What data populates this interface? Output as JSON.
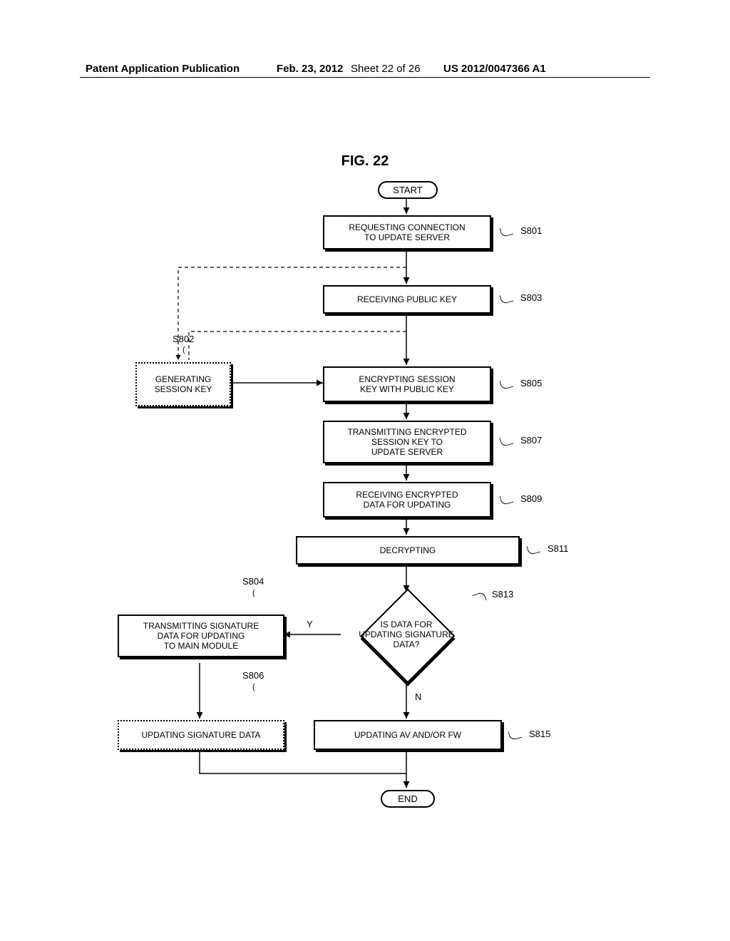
{
  "header": {
    "pub": "Patent Application Publication",
    "date": "Feb. 23, 2012",
    "sheet": "Sheet 22 of 26",
    "docnum": "US 2012/0047366 A1"
  },
  "figure_title": "FIG. 22",
  "nodes": {
    "start": "START",
    "s801": "REQUESTING CONNECTION\nTO UPDATE SERVER",
    "s803": "RECEIVING PUBLIC KEY",
    "s805": "ENCRYPTING SESSION\nKEY WITH PUBLIC KEY",
    "s807": "TRANSMITTING ENCRYPTED\nSESSION KEY TO\nUPDATE SERVER",
    "s809": "RECEIVING ENCRYPTED\nDATA FOR UPDATING",
    "s811": "DECRYPTING",
    "s813": "IS DATA FOR\nUPDATING SIGNATURE\nDATA?",
    "s815": "UPDATING AV AND/OR FW",
    "s802": "GENERATING\nSESSION KEY",
    "s804": "TRANSMITTING SIGNATURE\nDATA FOR UPDATING\nTO MAIN MODULE",
    "s806": "UPDATING SIGNATURE DATA",
    "end": "END"
  },
  "labels": {
    "s801": "S801",
    "s802": "S802",
    "s803": "S803",
    "s804": "S804",
    "s805": "S805",
    "s806": "S806",
    "s807": "S807",
    "s809": "S809",
    "s811": "S811",
    "s813": "S813",
    "s815": "S815",
    "yes": "Y",
    "no": "N"
  },
  "chart_data": {
    "type": "flowchart",
    "title": "FIG. 22",
    "nodes": [
      {
        "id": "start",
        "type": "terminator",
        "text": "START"
      },
      {
        "id": "S801",
        "type": "process",
        "text": "REQUESTING CONNECTION TO UPDATE SERVER"
      },
      {
        "id": "S803",
        "type": "process",
        "text": "RECEIVING PUBLIC KEY"
      },
      {
        "id": "S802",
        "type": "process",
        "text": "GENERATING SESSION KEY",
        "border": "dotted"
      },
      {
        "id": "S805",
        "type": "process",
        "text": "ENCRYPTING SESSION KEY WITH PUBLIC KEY"
      },
      {
        "id": "S807",
        "type": "process",
        "text": "TRANSMITTING ENCRYPTED SESSION KEY TO UPDATE SERVER"
      },
      {
        "id": "S809",
        "type": "process",
        "text": "RECEIVING ENCRYPTED DATA FOR UPDATING"
      },
      {
        "id": "S811",
        "type": "process",
        "text": "DECRYPTING"
      },
      {
        "id": "S813",
        "type": "decision",
        "text": "IS DATA FOR UPDATING SIGNATURE DATA?"
      },
      {
        "id": "S804",
        "type": "process",
        "text": "TRANSMITTING SIGNATURE DATA FOR UPDATING TO MAIN MODULE"
      },
      {
        "id": "S806",
        "type": "process",
        "text": "UPDATING SIGNATURE DATA",
        "border": "dotted"
      },
      {
        "id": "S815",
        "type": "process",
        "text": "UPDATING AV AND/OR FW"
      },
      {
        "id": "end",
        "type": "terminator",
        "text": "END"
      }
    ],
    "edges": [
      {
        "from": "start",
        "to": "S801"
      },
      {
        "from": "S801",
        "to": "S803"
      },
      {
        "from": "S801",
        "to": "S802",
        "style": "dashed"
      },
      {
        "from": "S803",
        "to": "S805"
      },
      {
        "from": "S803",
        "to": "S802",
        "style": "dashed"
      },
      {
        "from": "S802",
        "to": "S805"
      },
      {
        "from": "S805",
        "to": "S807"
      },
      {
        "from": "S807",
        "to": "S809"
      },
      {
        "from": "S809",
        "to": "S811"
      },
      {
        "from": "S811",
        "to": "S813"
      },
      {
        "from": "S813",
        "to": "S804",
        "label": "Y"
      },
      {
        "from": "S813",
        "to": "S815",
        "label": "N"
      },
      {
        "from": "S804",
        "to": "S806"
      },
      {
        "from": "S806",
        "to": "end"
      },
      {
        "from": "S815",
        "to": "end"
      }
    ]
  }
}
